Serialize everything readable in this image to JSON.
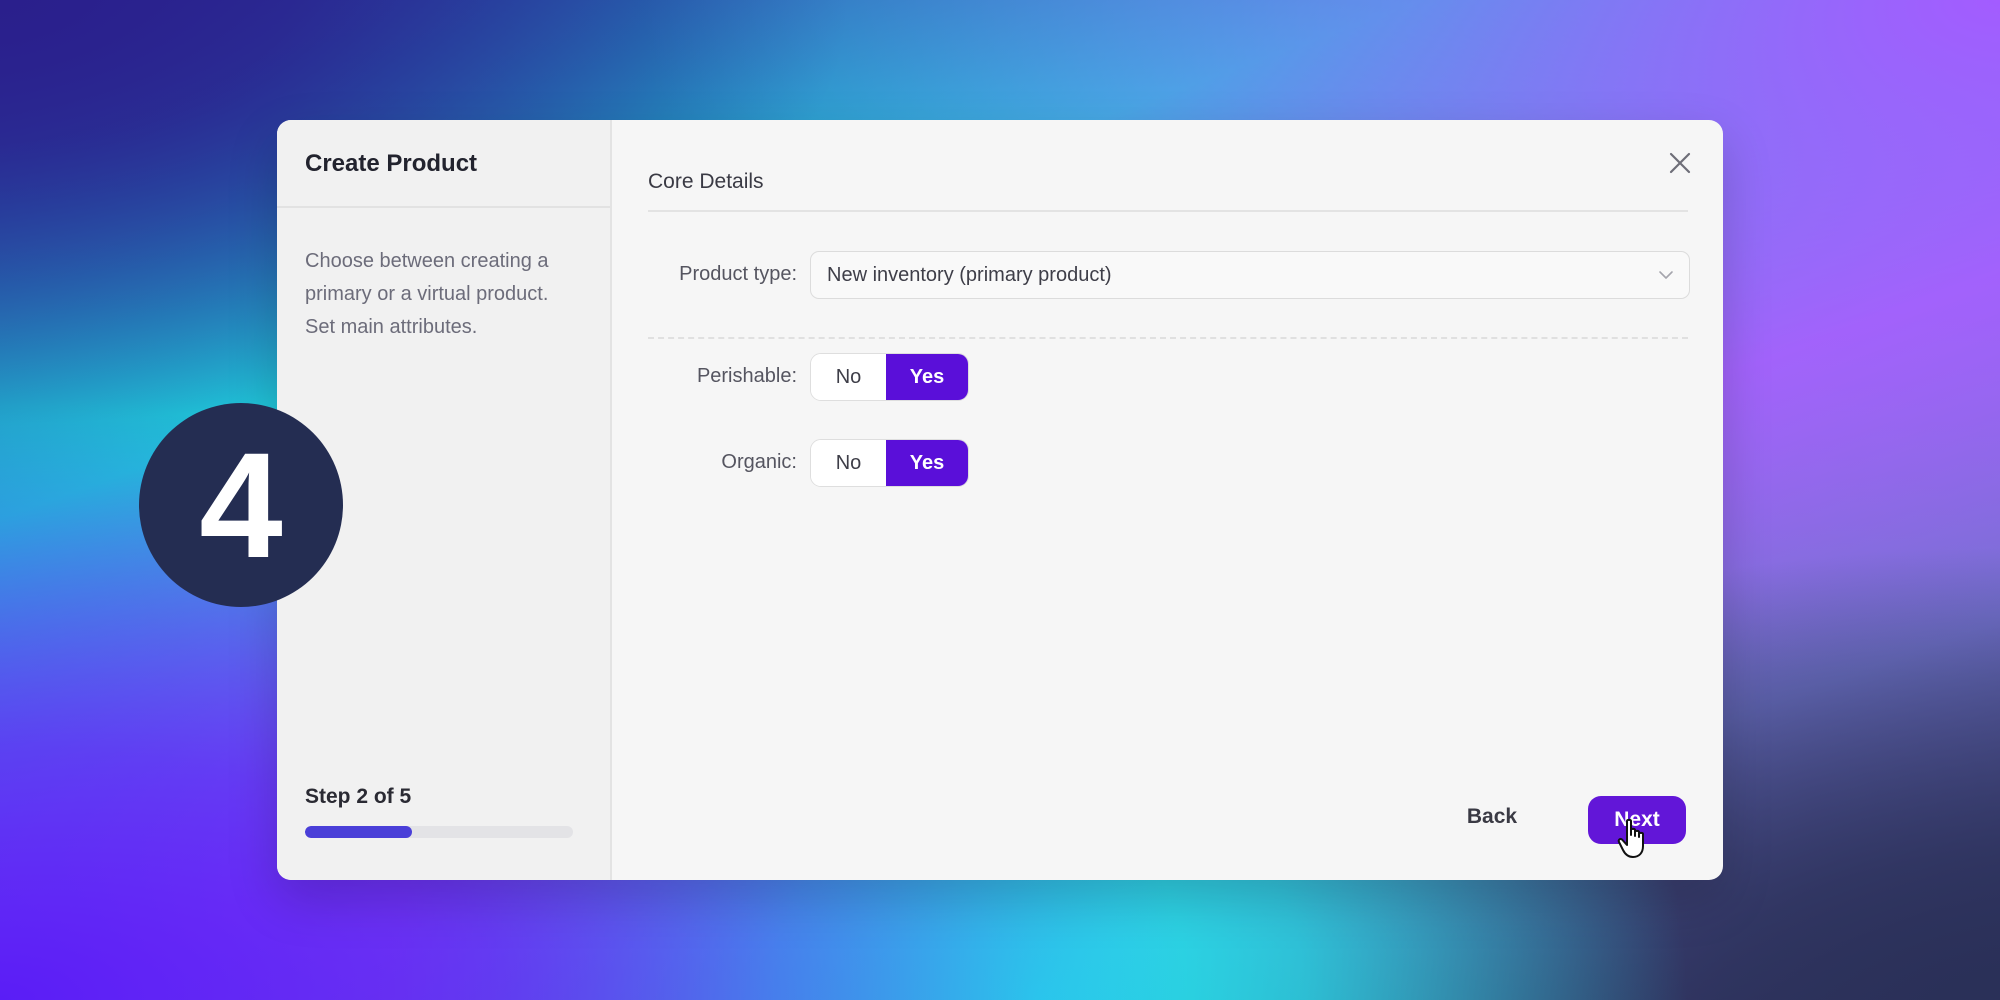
{
  "step_badge": {
    "number": "4"
  },
  "modal": {
    "sidebar": {
      "title": "Create Product",
      "description": "Choose between creating a primary or a virtual product. Set main attributes.",
      "step_label": "Step 2 of 5",
      "progress": 0.4
    },
    "section_title": "Core Details",
    "product_type": {
      "label": "Product type:",
      "value": "New inventory (primary product)"
    },
    "perishable": {
      "label": "Perishable:",
      "no_label": "No",
      "yes_label": "Yes",
      "selected": "Yes"
    },
    "organic": {
      "label": "Organic:",
      "no_label": "No",
      "yes_label": "Yes",
      "selected": "Yes"
    },
    "footer": {
      "back_label": "Back",
      "next_label": "Next"
    }
  },
  "colors": {
    "accent": "#5a0fd9",
    "next_button": "#6216d8",
    "progress_fill": "#4a3fd8",
    "badge": "#242d52"
  },
  "icons": {
    "close": "close-icon",
    "select_arrow": "chevron-down-icon",
    "cursor": "hand-pointer-icon"
  }
}
